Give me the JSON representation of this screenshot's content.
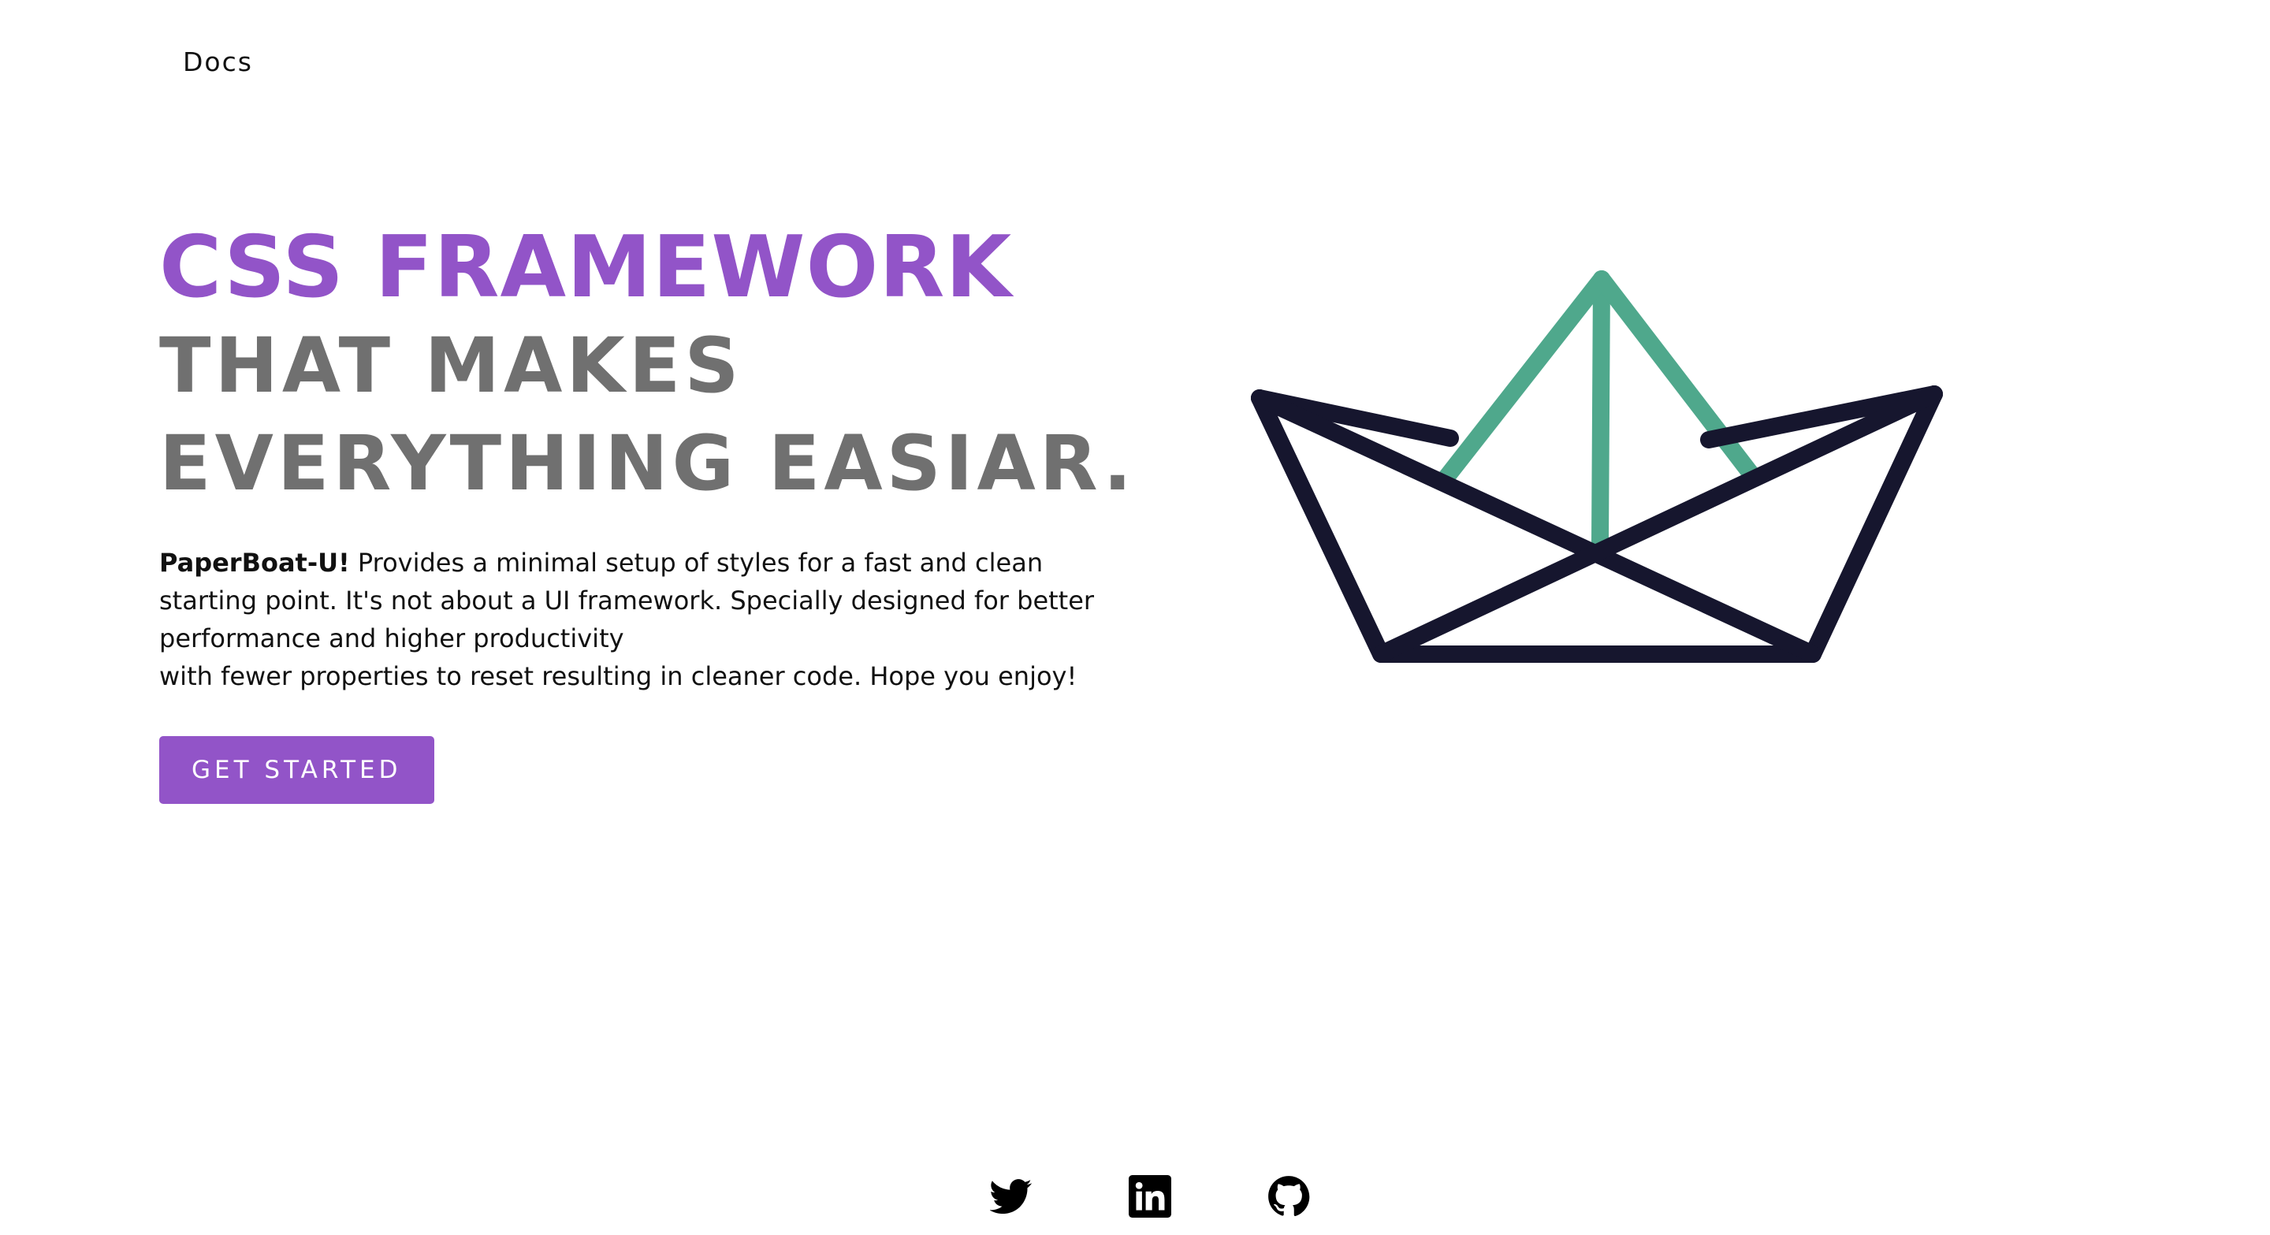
{
  "nav": {
    "docs_label": "Docs"
  },
  "hero": {
    "headline_accent": "CSS FRAMEWORK",
    "headline_line2": "THAT MAKES",
    "headline_line3": "EVERYTHING EASIAR.",
    "brand_name": "PaperBoat-U!",
    "description_part1": " Provides a minimal setup of styles for a fast and clean starting point. It's not about a UI framework. Specially designed for better performance and higher productivity",
    "description_part2": "with fewer properties to reset resulting in cleaner code. Hope you enjoy!",
    "cta_label": "GET STARTED"
  },
  "illustration": {
    "icon": "paper-boat-icon",
    "hull_color": "#16162e",
    "sail_color": "#4fa88c"
  },
  "social": [
    {
      "icon": "twitter-icon"
    },
    {
      "icon": "linkedin-icon"
    },
    {
      "icon": "github-icon"
    }
  ],
  "colors": {
    "accent": "#9254c8",
    "heading_grey": "#707070",
    "text": "#111111",
    "background": "#ffffff"
  }
}
